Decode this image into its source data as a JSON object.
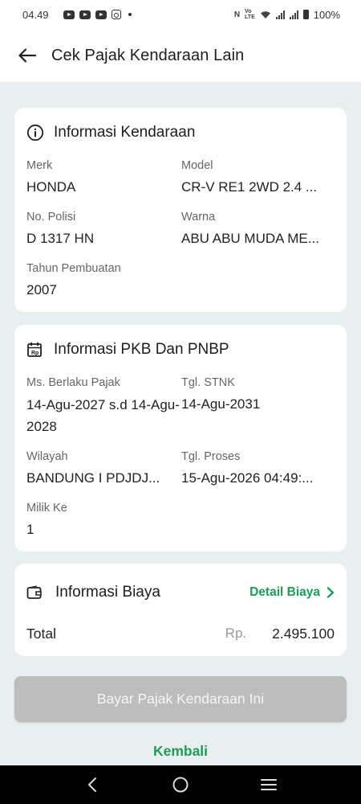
{
  "status_bar": {
    "time": "04.49",
    "battery": "100%",
    "network": "Vo LTE"
  },
  "header": {
    "title": "Cek Pajak Kendaraan Lain",
    "back_icon": "arrow-left-icon"
  },
  "vehicle_info": {
    "title": "Informasi Kendaraan",
    "icon": "info-icon",
    "fields": [
      {
        "label": "Merk",
        "value": "HONDA"
      },
      {
        "label": "Model",
        "value": "CR-V RE1 2WD 2.4 ..."
      },
      {
        "label": "No. Polisi",
        "value": "D 1317 HN"
      },
      {
        "label": "Warna",
        "value": "ABU ABU MUDA ME..."
      },
      {
        "label": "Tahun Pembuatan",
        "value": "2007"
      }
    ]
  },
  "pkb_info": {
    "title": "Informasi PKB Dan PNBP",
    "icon": "calendar-money-icon",
    "fields": [
      {
        "label": "Ms. Berlaku Pajak",
        "value": "14-Agu-2027 s.d 14-Agu-2028"
      },
      {
        "label": "Tgl. STNK",
        "value": "14-Agu-2031"
      },
      {
        "label": "Wilayah",
        "value": "BANDUNG I PDJDJ..."
      },
      {
        "label": "Tgl. Proses",
        "value": "15-Agu-2026 04:49:..."
      },
      {
        "label": "Milik Ke",
        "value": "1"
      }
    ]
  },
  "cost_info": {
    "title": "Informasi Biaya",
    "icon": "wallet-icon",
    "detail_link": "Detail Biaya",
    "total_label": "Total",
    "currency": "Rp.",
    "total_amount": "2.495.100"
  },
  "actions": {
    "pay_button": "Bayar Pajak Kendaraan Ini",
    "back_link": "Kembali"
  },
  "colors": {
    "accent": "#1f9a5a",
    "background": "#e8efee",
    "disabled_button": "#bdbdbd"
  }
}
